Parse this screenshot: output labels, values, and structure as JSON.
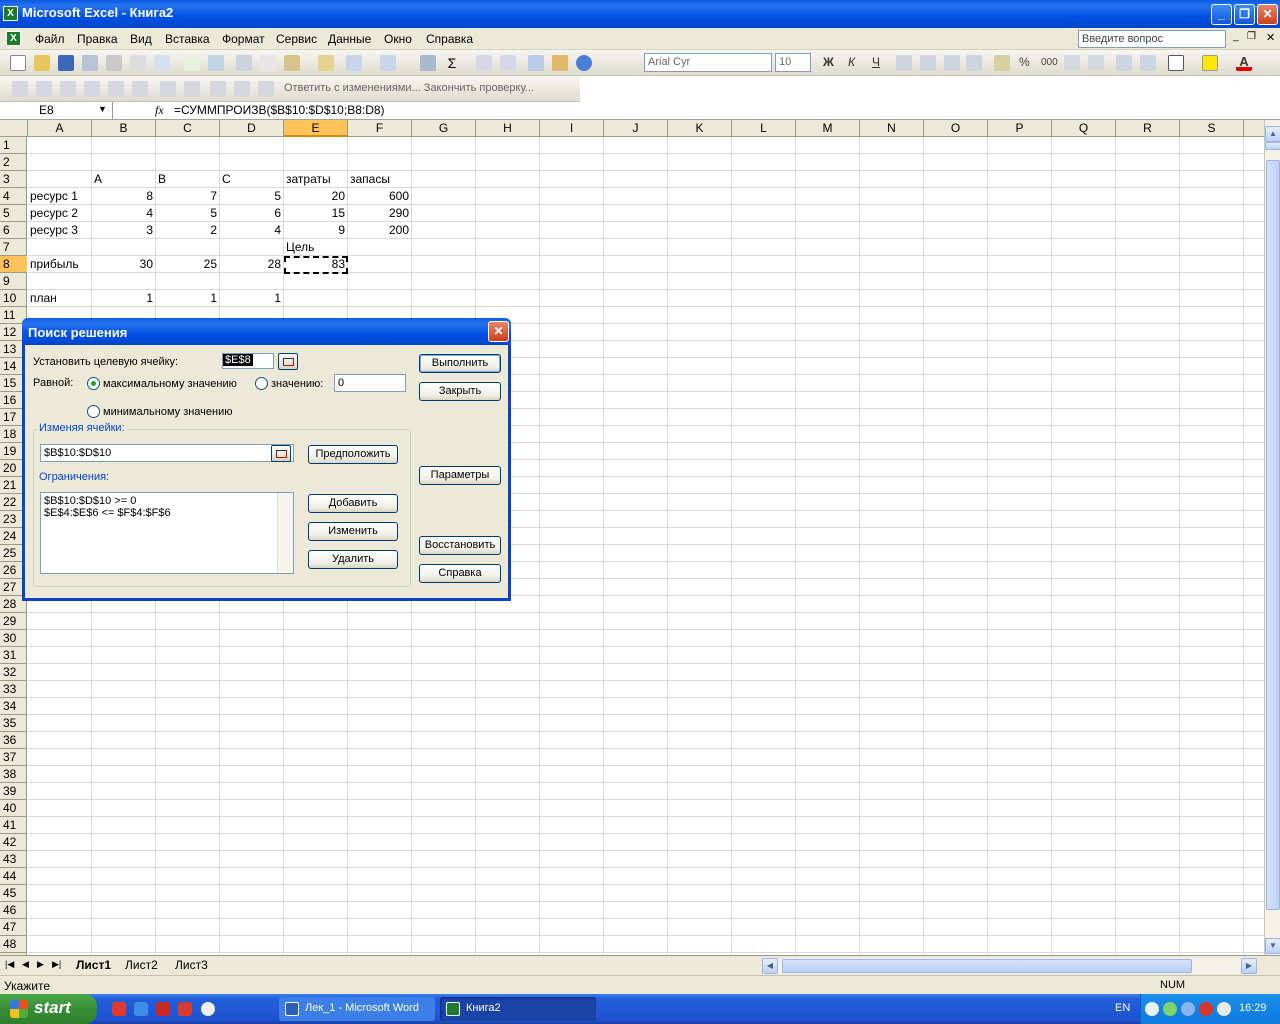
{
  "window": {
    "title": "Microsoft Excel - Книга2"
  },
  "menu": [
    "Файл",
    "Правка",
    "Вид",
    "Вставка",
    "Формат",
    "Сервис",
    "Данные",
    "Окно",
    "Справка"
  ],
  "ask_placeholder": "Введите вопрос",
  "toolbar": {
    "font": "Arial Cyr",
    "size": "10",
    "bold": "Ж",
    "italic": "К",
    "underline": "Ч",
    "percent": "%",
    "thousands": "000",
    "review_text": "Ответить с изменениями...  Закончить проверку..."
  },
  "formula_bar": {
    "name_box": "E8",
    "fx": "fx",
    "formula": "=СУММПРОИЗВ($B$10:$D$10;B8:D8)"
  },
  "columns": [
    "A",
    "B",
    "C",
    "D",
    "E",
    "F",
    "G",
    "H",
    "I",
    "J",
    "K",
    "L",
    "M",
    "N",
    "O",
    "P",
    "Q",
    "R",
    "S"
  ],
  "rows": [
    "1",
    "2",
    "3",
    "4",
    "5",
    "6",
    "7",
    "8",
    "9",
    "10",
    "11",
    "12",
    "13",
    "14",
    "15",
    "16",
    "17",
    "18",
    "19",
    "20",
    "21",
    "22",
    "23",
    "24",
    "25",
    "26",
    "27",
    "28",
    "29",
    "30",
    "31",
    "32",
    "33",
    "34",
    "35",
    "36",
    "37",
    "38",
    "39",
    "40",
    "41",
    "42",
    "43",
    "44",
    "45",
    "46",
    "47",
    "48"
  ],
  "cells": {
    "B3": "A",
    "C3": "B",
    "D3": "C",
    "E3": "затраты",
    "F3": "запасы",
    "A4": "ресурс 1",
    "B4": "8",
    "C4": "7",
    "D4": "5",
    "E4": "20",
    "F4": "600",
    "A5": "ресурс 2",
    "B5": "4",
    "C5": "5",
    "D5": "6",
    "E5": "15",
    "F5": "290",
    "A6": "ресурс 3",
    "B6": "3",
    "C6": "2",
    "D6": "4",
    "E6": "9",
    "F6": "200",
    "E7": "Цель",
    "A8": "прибыль",
    "B8": "30",
    "C8": "25",
    "D8": "28",
    "E8": "83",
    "A10": "план",
    "B10": "1",
    "C10": "1",
    "D10": "1"
  },
  "sheet_tabs": [
    "Лист1",
    "Лист2",
    "Лист3"
  ],
  "status": {
    "text": "Укажите",
    "num": "NUM"
  },
  "taskbar": {
    "start": "start",
    "tasks": [
      "Лек_1 - Microsoft Word",
      "Книга2"
    ],
    "lang": "EN",
    "time": "16:29"
  },
  "dialog": {
    "title": "Поиск решения",
    "target_label": "Установить целевую ячейку:",
    "target_value": "$E$8",
    "equal_label": "Равной:",
    "opt_max": "максимальному значению",
    "opt_value": "значению:",
    "value_input": "0",
    "opt_min": "минимальному значению",
    "changing_label": "Изменяя ячейки:",
    "changing_value": "$B$10:$D$10",
    "guess_btn": "Предположить",
    "constraints_label": "Ограничения:",
    "constraints": [
      "$B$10:$D$10 >= 0",
      "$E$4:$E$6 <= $F$4:$F$6"
    ],
    "add_btn": "Добавить",
    "change_btn": "Изменить",
    "delete_btn": "Удалить",
    "solve_btn": "Выполнить",
    "close_btn": "Закрыть",
    "options_btn": "Параметры",
    "reset_btn": "Восстановить",
    "help_btn": "Справка"
  }
}
